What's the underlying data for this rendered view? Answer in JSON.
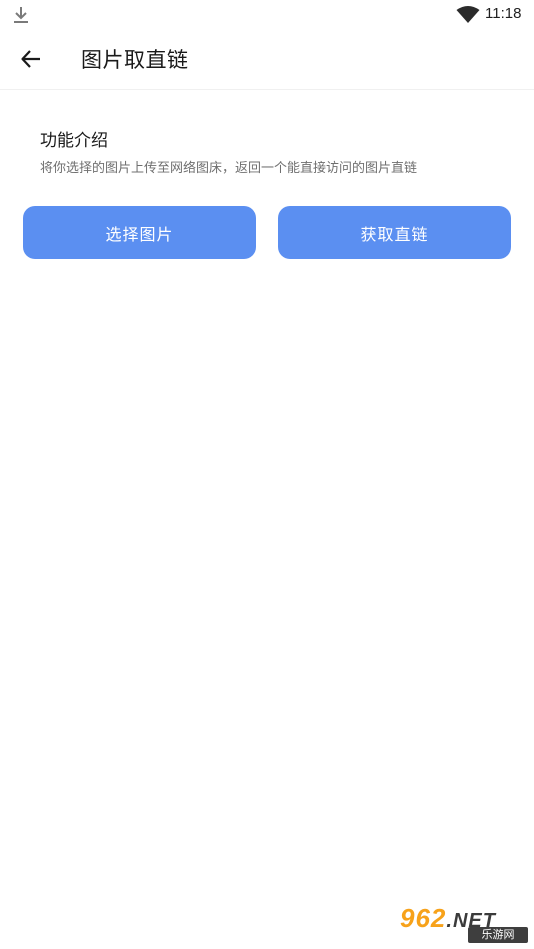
{
  "status_bar": {
    "time": "11:18",
    "icons": [
      "download-icon",
      "wifi-icon"
    ]
  },
  "app_bar": {
    "title": "图片取直链",
    "back_icon": "arrow-left-icon"
  },
  "intro": {
    "heading": "功能介绍",
    "description": "将你选择的图片上传至网络图床，返回一个能直接访问的图片直链"
  },
  "actions": {
    "select_image_label": "选择图片",
    "get_link_label": "获取直链",
    "accent_color": "#5b8ff1"
  },
  "watermark": {
    "brand": "962",
    "suffix": ".NET",
    "sub": "乐游网"
  }
}
